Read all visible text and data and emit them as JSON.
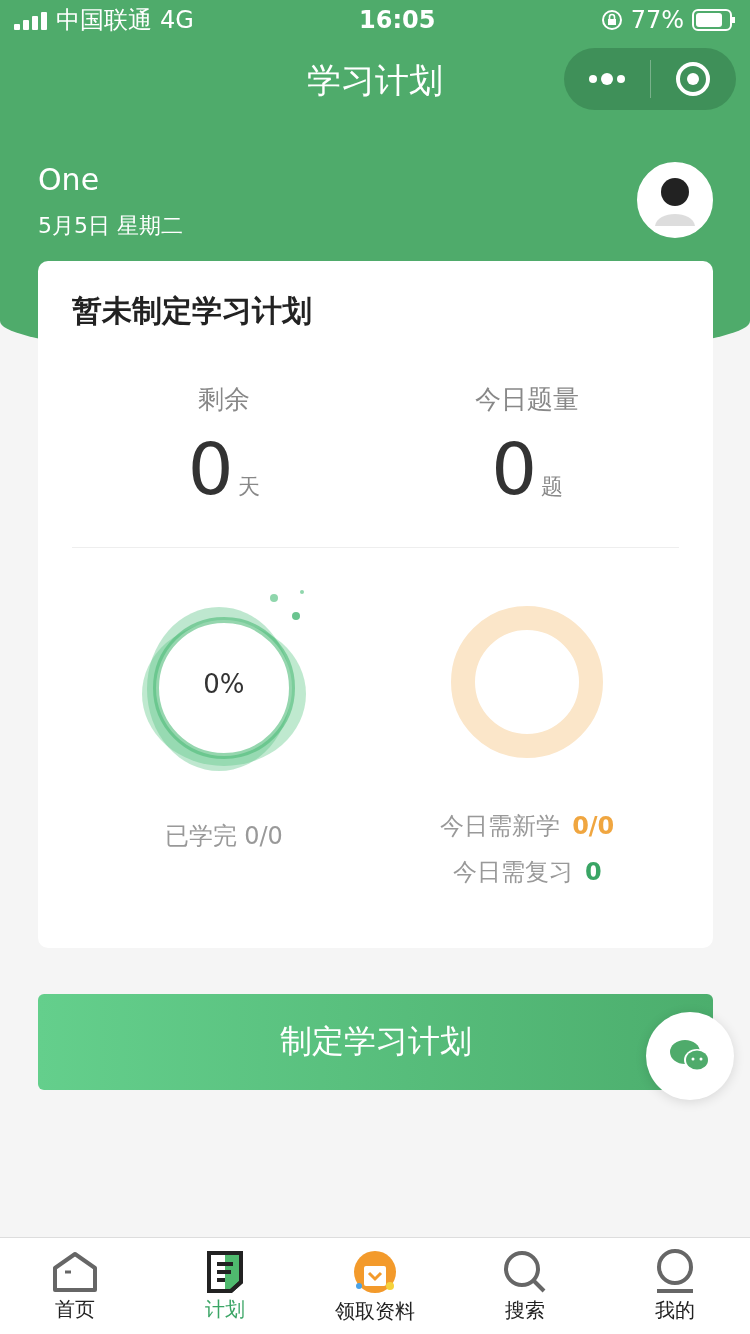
{
  "status_bar": {
    "carrier": "中国联通",
    "network": "4G",
    "time": "16:05",
    "battery": "77%"
  },
  "nav": {
    "title": "学习计划"
  },
  "profile": {
    "name": "One",
    "date": "5月5日  星期二"
  },
  "plan_card": {
    "title": "暂未制定学习计划",
    "stats": [
      {
        "label": "剩余",
        "value": "0",
        "unit": "天"
      },
      {
        "label": "今日题量",
        "value": "0",
        "unit": "题"
      }
    ],
    "progress": {
      "percent": "0%",
      "caption": "已学完 0/0"
    },
    "today": [
      {
        "label": "今日需新学",
        "value": "0/0",
        "color": "#f0a640"
      },
      {
        "label": "今日需复习",
        "value": "0",
        "color": "#3aa565"
      }
    ]
  },
  "action_button": "制定学习计划",
  "tabs": [
    {
      "kind": "home",
      "label": "首页",
      "selected": false
    },
    {
      "kind": "plan",
      "label": "计划",
      "selected": true
    },
    {
      "kind": "gift",
      "label": "领取资料",
      "selected": false
    },
    {
      "kind": "search",
      "label": "搜索",
      "selected": false
    },
    {
      "kind": "profile",
      "label": "我的",
      "selected": false
    }
  ]
}
